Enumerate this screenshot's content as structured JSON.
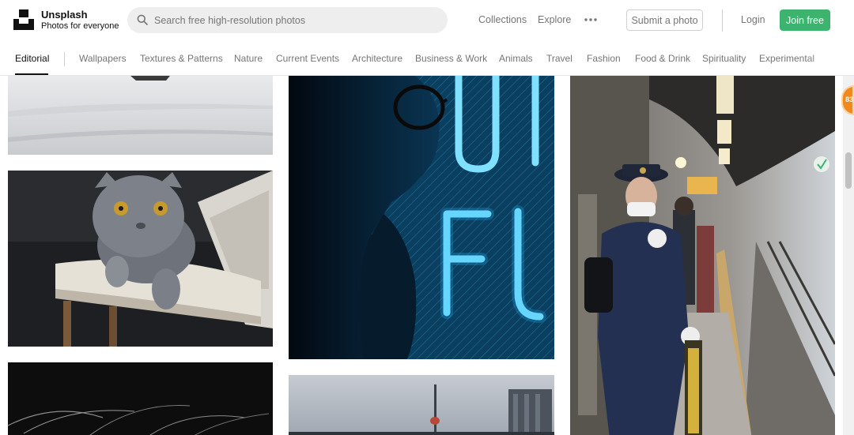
{
  "header": {
    "brand_name": "Unsplash",
    "brand_tagline": "Photos for everyone",
    "search_placeholder": "Search free high-resolution photos",
    "nav": [
      {
        "label": "Collections"
      },
      {
        "label": "Explore"
      }
    ],
    "more_icon": "more-horizontal-icon",
    "submit_label": "Submit a photo",
    "login_label": "Login",
    "join_label": "Join free",
    "colors": {
      "accent_green": "#3cb46e",
      "muted_text": "#767676",
      "search_bg": "#eeeeee"
    }
  },
  "topics": {
    "items": [
      {
        "label": "Editorial",
        "active": true
      },
      {
        "label": "Wallpapers"
      },
      {
        "label": "Textures & Patterns"
      },
      {
        "label": "Nature"
      },
      {
        "label": "Current Events"
      },
      {
        "label": "Architecture"
      },
      {
        "label": "Business & Work"
      },
      {
        "label": "Animals"
      },
      {
        "label": "Travel"
      },
      {
        "label": "Fashion"
      },
      {
        "label": "Food & Drink"
      },
      {
        "label": "Spirituality"
      },
      {
        "label": "Experimental"
      }
    ]
  },
  "gallery": {
    "photos": [
      {
        "subject": "snowy-landscape"
      },
      {
        "subject": "grey-scottish-fold-cat-on-chair"
      },
      {
        "subject": "dark-grass-silhouette"
      },
      {
        "subject": "person-with-glasses-blue-neon-sign"
      },
      {
        "subject": "city-skyline-cn-tower"
      },
      {
        "subject": "train-station-conductor"
      }
    ]
  },
  "floating_badge": {
    "text": "83",
    "color": "#f08a1c"
  }
}
